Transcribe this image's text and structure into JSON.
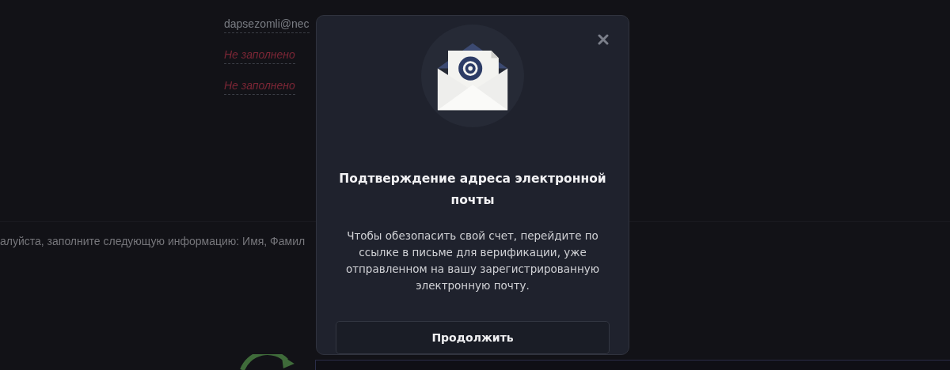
{
  "profile": {
    "fields": [
      {
        "value": "dapsezomli@nec",
        "filled": true
      },
      {
        "value": "Не заполнено",
        "filled": false
      },
      {
        "value": "Не заполнено",
        "filled": false
      }
    ]
  },
  "notice": "алуйста, заполните следующую информацию: Имя, Фамил",
  "modal": {
    "title": "Подтверждение адреса электронной почты",
    "message": "Чтобы обезопасить свой счет, перейдите по ссылке в письме для верификации, уже отправленном на вашу зарегистрированную электронную почту.",
    "button": "Продолжить"
  }
}
